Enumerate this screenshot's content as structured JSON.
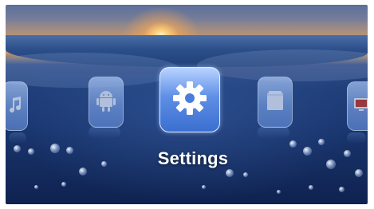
{
  "menu": {
    "selected_label": "Settings",
    "items": [
      {
        "id": "music",
        "icon": "music-icon"
      },
      {
        "id": "android",
        "icon": "android-icon"
      },
      {
        "id": "settings",
        "icon": "gear-icon"
      },
      {
        "id": "folder",
        "icon": "folder-icon"
      },
      {
        "id": "video",
        "icon": "monitor-icon"
      }
    ]
  },
  "colors": {
    "tile_accent": "#3a6fd0",
    "label_text": "#ffffff"
  }
}
